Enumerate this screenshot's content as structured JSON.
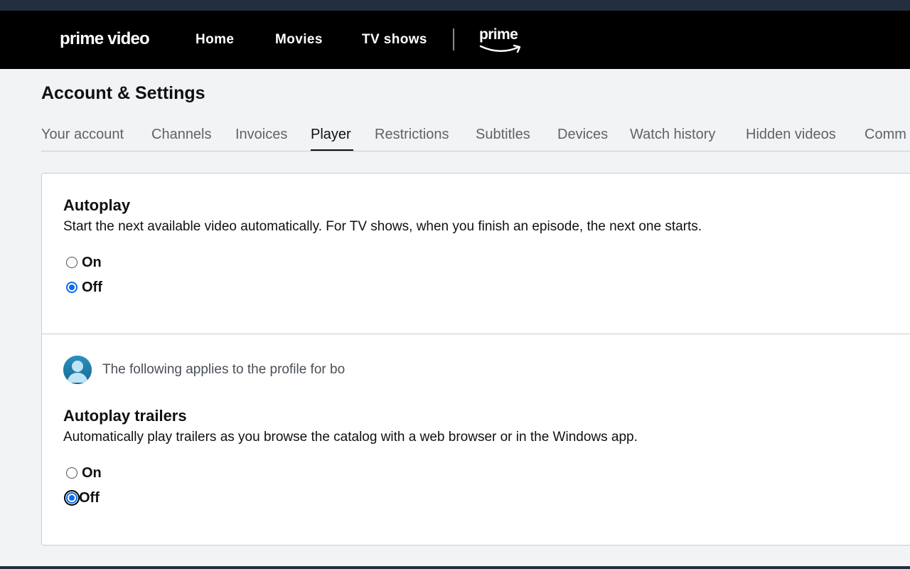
{
  "nav": {
    "logo": "prime video",
    "links": [
      "Home",
      "Movies",
      "TV shows"
    ],
    "badge": "prime"
  },
  "page": {
    "title": "Account & Settings"
  },
  "tabs": [
    {
      "label": "Your account",
      "active": false
    },
    {
      "label": "Channels",
      "active": false
    },
    {
      "label": "Invoices",
      "active": false
    },
    {
      "label": "Player",
      "active": true
    },
    {
      "label": "Restrictions",
      "active": false
    },
    {
      "label": "Subtitles",
      "active": false
    },
    {
      "label": "Devices",
      "active": false
    },
    {
      "label": "Watch history",
      "active": false
    },
    {
      "label": "Hidden videos",
      "active": false
    },
    {
      "label": "Comm",
      "active": false
    }
  ],
  "autoplay": {
    "title": "Autoplay",
    "description": "Start the next available video automatically. For TV shows, when you finish an episode, the next one starts.",
    "options": [
      "On",
      "Off"
    ],
    "selected": "Off"
  },
  "profile": {
    "text": "The following applies to the profile for bo",
    "icon": "user-avatar-icon"
  },
  "autoplay_trailers": {
    "title": "Autoplay trailers",
    "description": "Automatically play trailers as you browse the catalog with a web browser or in the Windows app.",
    "options": [
      "On",
      "Off"
    ],
    "selected": "Off"
  },
  "colors": {
    "navbar": "#000000",
    "top_strip": "#232f3e",
    "page_bg": "#f2f3f4",
    "radio_accent": "#0b6ce8"
  }
}
